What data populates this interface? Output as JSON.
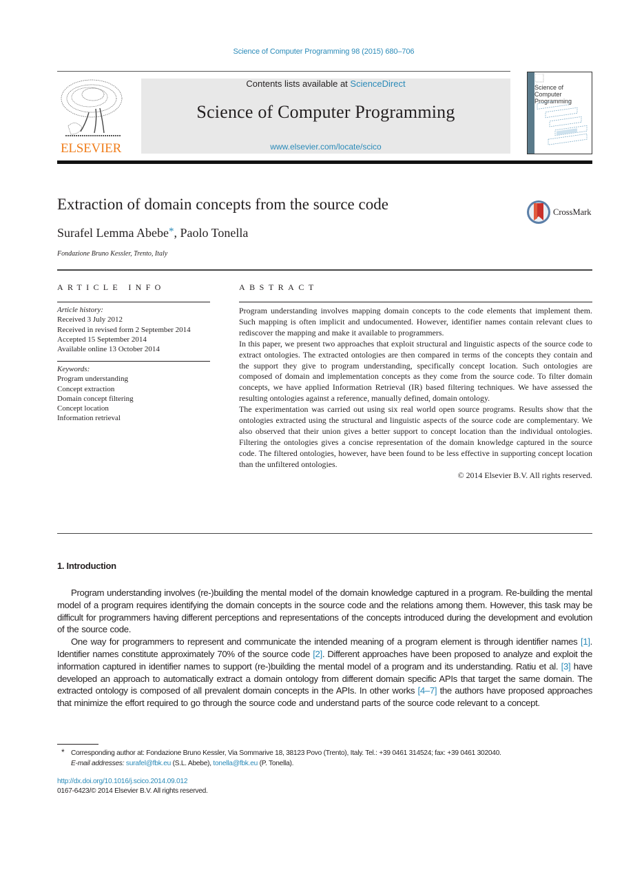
{
  "header": {
    "journal_ref": "Science of Computer Programming 98 (2015) 680–706",
    "contents_prefix": "Contents lists available at ",
    "contents_link": "ScienceDirect",
    "journal_title": "Science of Computer Programming",
    "journal_url": "www.elsevier.com/locate/scico",
    "publisher_logo_text": "ELSEVIER",
    "cover_title": "Science of Computer Programming",
    "crossmark_label": "CrossMark"
  },
  "colors": {
    "link": "#2a8ab8",
    "publisher_orange": "#f07e1c",
    "masthead_bg": "#e8e8e8",
    "text": "#231f20"
  },
  "article": {
    "title": "Extraction of domain concepts from the source code",
    "authors": [
      {
        "name": "Surafel Lemma Abebe",
        "mark": "*"
      },
      {
        "name": "Paolo Tonella",
        "mark": ""
      }
    ],
    "author_separator": ", ",
    "affiliation": "Fondazione Bruno Kessler, Trento, Italy"
  },
  "article_info": {
    "heading": "ARTICLE INFO",
    "history_label": "Article history:",
    "history": [
      "Received 3 July 2012",
      "Received in revised form 2 September 2014",
      "Accepted 15 September 2014",
      "Available online 13 October 2014"
    ],
    "keywords_label": "Keywords:",
    "keywords": [
      "Program understanding",
      "Concept extraction",
      "Domain concept filtering",
      "Concept location",
      "Information retrieval"
    ]
  },
  "abstract": {
    "heading": "ABSTRACT",
    "paragraphs": [
      "Program understanding involves mapping domain concepts to the code elements that implement them. Such mapping is often implicit and undocumented. However, identifier names contain relevant clues to rediscover the mapping and make it available to programmers.",
      "In this paper, we present two approaches that exploit structural and linguistic aspects of the source code to extract ontologies. The extracted ontologies are then compared in terms of the concepts they contain and the support they give to program understanding, specifically concept location. Such ontologies are composed of domain and implementation concepts as they come from the source code. To filter domain concepts, we have applied Information Retrieval (IR) based filtering techniques. We have assessed the resulting ontologies against a reference, manually defined, domain ontology.",
      "The experimentation was carried out using six real world open source programs. Results show that the ontologies extracted using the structural and linguistic aspects of the source code are complementary. We also observed that their union gives a better support to concept location than the individual ontologies. Filtering the ontologies gives a concise representation of the domain knowledge captured in the source code. The filtered ontologies, however, have been found to be less effective in supporting concept location than the unfiltered ontologies."
    ],
    "copyright": "© 2014 Elsevier B.V. All rights reserved."
  },
  "introduction": {
    "heading": "1.  Introduction",
    "p1": "Program understanding involves (re-)building the mental model of the domain knowledge captured in a program. Re-building the mental model of a program requires identifying the domain concepts in the source code and the relations among them. However, this task may be difficult for programmers having different perceptions and representations of the concepts introduced during the development and evolution of the source code.",
    "p2_segments": [
      {
        "text": "One way for programmers to represent and communicate the intended meaning of a program element is through identifier names ",
        "link": false
      },
      {
        "text": "[1]",
        "link": true
      },
      {
        "text": ". Identifier names constitute approximately 70% of the source code ",
        "link": false
      },
      {
        "text": "[2]",
        "link": true
      },
      {
        "text": ". Different approaches have been proposed to analyze and exploit the information captured in identifier names to support (re-)building the mental model of a program and its understanding. Ratiu et al. ",
        "link": false
      },
      {
        "text": "[3]",
        "link": true
      },
      {
        "text": " have developed an approach to automatically extract a domain ontology from different domain specific APIs that target the same domain. The extracted ontology is composed of all prevalent domain concepts in the APIs. In other works ",
        "link": false
      },
      {
        "text": "[4–7]",
        "link": true
      },
      {
        "text": " the authors have proposed approaches that minimize the effort required to go through the source code and understand parts of the source code relevant to a concept.",
        "link": false
      }
    ]
  },
  "footnote": {
    "mark": "*",
    "corresponding": "Corresponding author at: Fondazione Bruno Kessler, Via Sommarive 18, 38123 Povo (Trento), Italy. Tel.: +39 0461 314524; fax: +39 0461 302040.",
    "email_label": "E-mail addresses: ",
    "email_1": "surafel@fbk.eu",
    "email_1_who": " (S.L. Abebe), ",
    "email_2": "tonella@fbk.eu",
    "email_2_who": " (P. Tonella)."
  },
  "doi": "http://dx.doi.org/10.1016/j.scico.2014.09.012",
  "issn_line": "0167-6423/© 2014 Elsevier B.V. All rights reserved."
}
